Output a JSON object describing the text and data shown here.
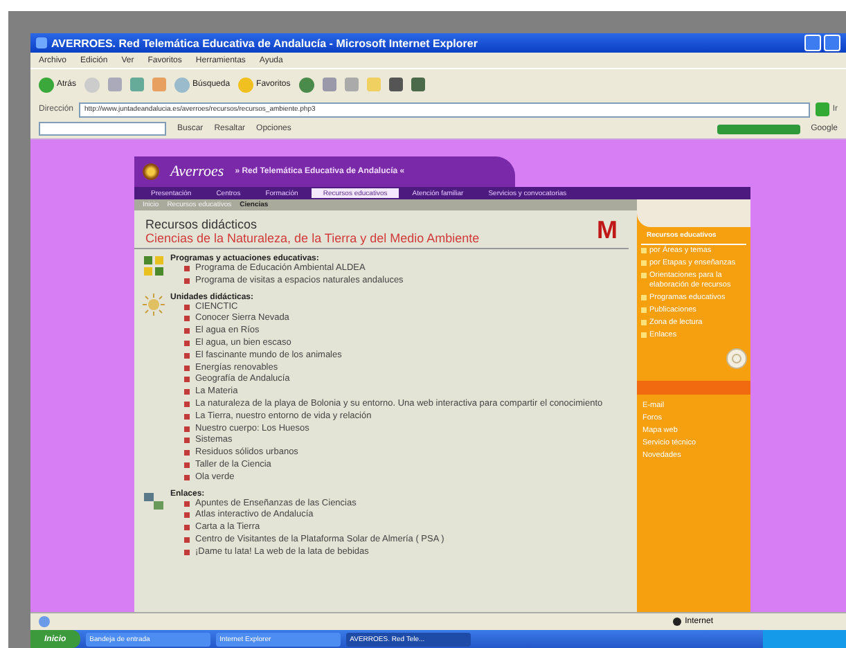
{
  "window": {
    "title": "AVERROES. Red Telemática Educativa de Andalucía - Microsoft Internet Explorer"
  },
  "menu": [
    "Archivo",
    "Edición",
    "Ver",
    "Favoritos",
    "Herramientas",
    "Ayuda"
  ],
  "toolbar": {
    "back": "Atrás",
    "search": "Búsqueda",
    "favorites": "Favoritos"
  },
  "address_bar": {
    "label": "Dirección",
    "value": "http://www.juntadeandalucia.es/averroes/recursos/recursos_ambiente.php3",
    "go": "Ir"
  },
  "links_bar": {
    "search": "Buscar",
    "highlight": "Resaltar",
    "options": "Opciones",
    "google": "Google"
  },
  "site": {
    "logo": "Averroes",
    "tagline": "» Red Telemática Educativa de Andalucía «",
    "nav": [
      {
        "label": "Presentación",
        "selected": false
      },
      {
        "label": "Centros",
        "selected": false
      },
      {
        "label": "Formación",
        "selected": false
      },
      {
        "label": "Recursos educativos",
        "selected": true
      },
      {
        "label": "Atención familiar",
        "selected": false
      },
      {
        "label": "Servicios y convocatorias",
        "selected": false
      }
    ],
    "breadcrumb": [
      "Inicio",
      "Recursos educativos",
      "Ciencias"
    ],
    "heading": "Recursos didácticos",
    "subheading": "Ciencias de la Naturaleza, de la Tierra y del Medio Ambiente",
    "badge": "M",
    "sections": [
      {
        "kind": "programs",
        "title": "Programas y actuaciones educativas:",
        "items": [
          "Programa de Educación Ambiental ALDEA",
          "Programa de visitas a espacios naturales andaluces"
        ]
      },
      {
        "kind": "units",
        "title": "Unidades didácticas:",
        "items": [
          "CIENCTIC",
          "Conocer Sierra Nevada",
          "El agua en Ríos",
          "El agua, un bien escaso",
          "El fascinante mundo de los animales",
          "Energías renovables",
          "Geografía de Andalucía",
          "La Materia",
          "La naturaleza de la playa de Bolonia y su entorno. Una web interactiva para compartir el conocimiento",
          "La Tierra, nuestro entorno de vida y relación",
          "Nuestro cuerpo: Los Huesos",
          "Sistemas",
          "Residuos sólidos urbanos",
          "Taller de la Ciencia",
          "Ola verde"
        ]
      },
      {
        "kind": "links",
        "title": "Enlaces:",
        "items": [
          "Apuntes de Enseñanzas de las Ciencias",
          "Atlas interactivo de Andalucía",
          "Carta a la Tierra",
          "Centro de Visitantes de la Plataforma Solar de Almería ( PSA )",
          "¡Dame tu lata! La web de la lata de bebidas"
        ]
      }
    ],
    "sidebar": {
      "title": "Recursos educativos",
      "items": [
        "por Áreas y temas",
        "por Etapas y enseñanzas",
        "Orientaciones para la elaboración de recursos",
        "Programas educativos",
        "Publicaciones",
        "Zona de lectura",
        "Enlaces"
      ],
      "tools": [
        "E-mail",
        "Foros",
        "Mapa web",
        "Servicio técnico",
        "Novedades"
      ]
    }
  },
  "status_bar": {
    "zone": "Internet"
  },
  "taskbar": {
    "start": "Inicio",
    "tasks": [
      {
        "label": "Bandeja de entrada",
        "selected": false
      },
      {
        "label": "Internet Explorer",
        "selected": false
      },
      {
        "label": "AVERROES. Red Tele...",
        "selected": true
      }
    ]
  }
}
